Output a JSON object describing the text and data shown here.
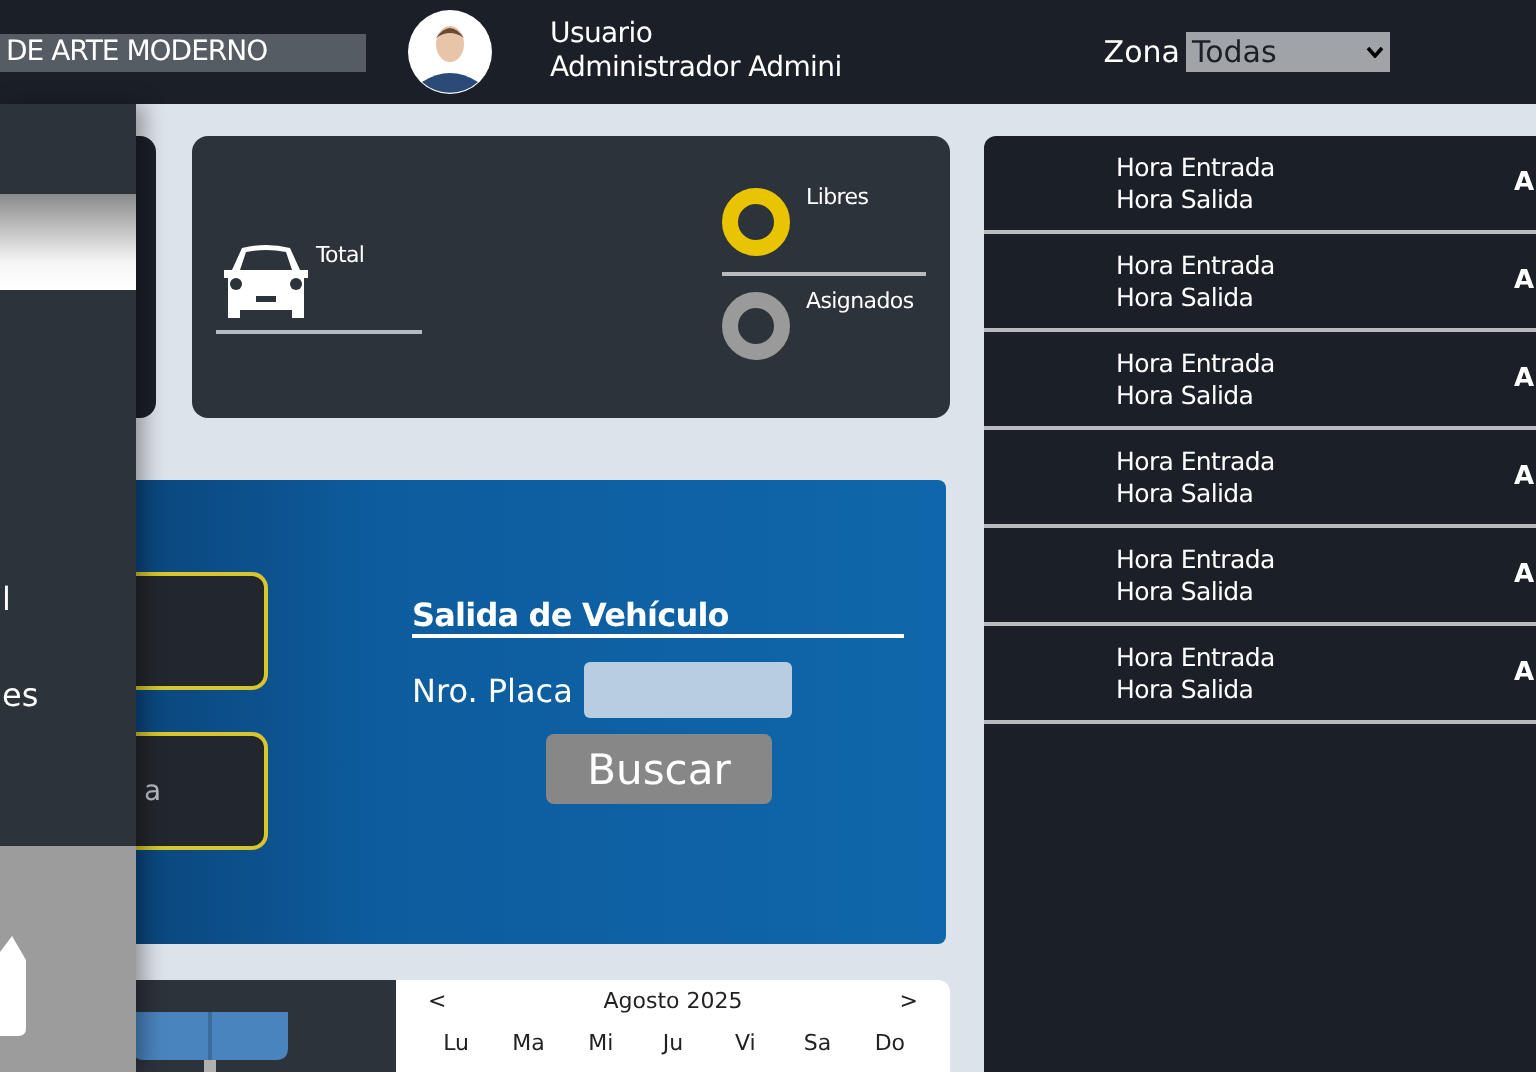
{
  "header": {
    "title": "DE ARTE MODERNO",
    "user_label": "Usuario",
    "user_name": "Administrador Admini",
    "zone_label": "Zona",
    "zone_value": "Todas"
  },
  "sidebar": {
    "items": [
      {
        "label": "l"
      },
      {
        "label": "es"
      }
    ]
  },
  "stats": {
    "total_label": "Total",
    "legend": [
      {
        "label": "Libres",
        "color": "#e8c500"
      },
      {
        "label": "Asignados",
        "color": "#9a9a9a"
      }
    ]
  },
  "side_boxes_text": "a",
  "exit": {
    "title": "Salida de Vehículo",
    "plate_label": "Nro. Placa",
    "button": "Buscar"
  },
  "calendar": {
    "prev": "<",
    "month": "Agosto 2025",
    "next": ">",
    "weekdays": [
      "Lu",
      "Ma",
      "Mi",
      "Ju",
      "Vi",
      "Sa",
      "Do"
    ]
  },
  "records": [
    {
      "entry": "Hora Entrada",
      "exit": "Hora Salida",
      "column_3": "A"
    },
    {
      "entry": "Hora Entrada",
      "exit": "Hora Salida",
      "column_3": "A"
    },
    {
      "entry": "Hora Entrada",
      "exit": "Hora Salida",
      "column_3": "A"
    },
    {
      "entry": "Hora Entrada",
      "exit": "Hora Salida",
      "column_3": "A"
    },
    {
      "entry": "Hora Entrada",
      "exit": "Hora Salida",
      "column_3": "A"
    },
    {
      "entry": "Hora Entrada",
      "exit": "Hora Salida",
      "column_3": "A"
    }
  ]
}
